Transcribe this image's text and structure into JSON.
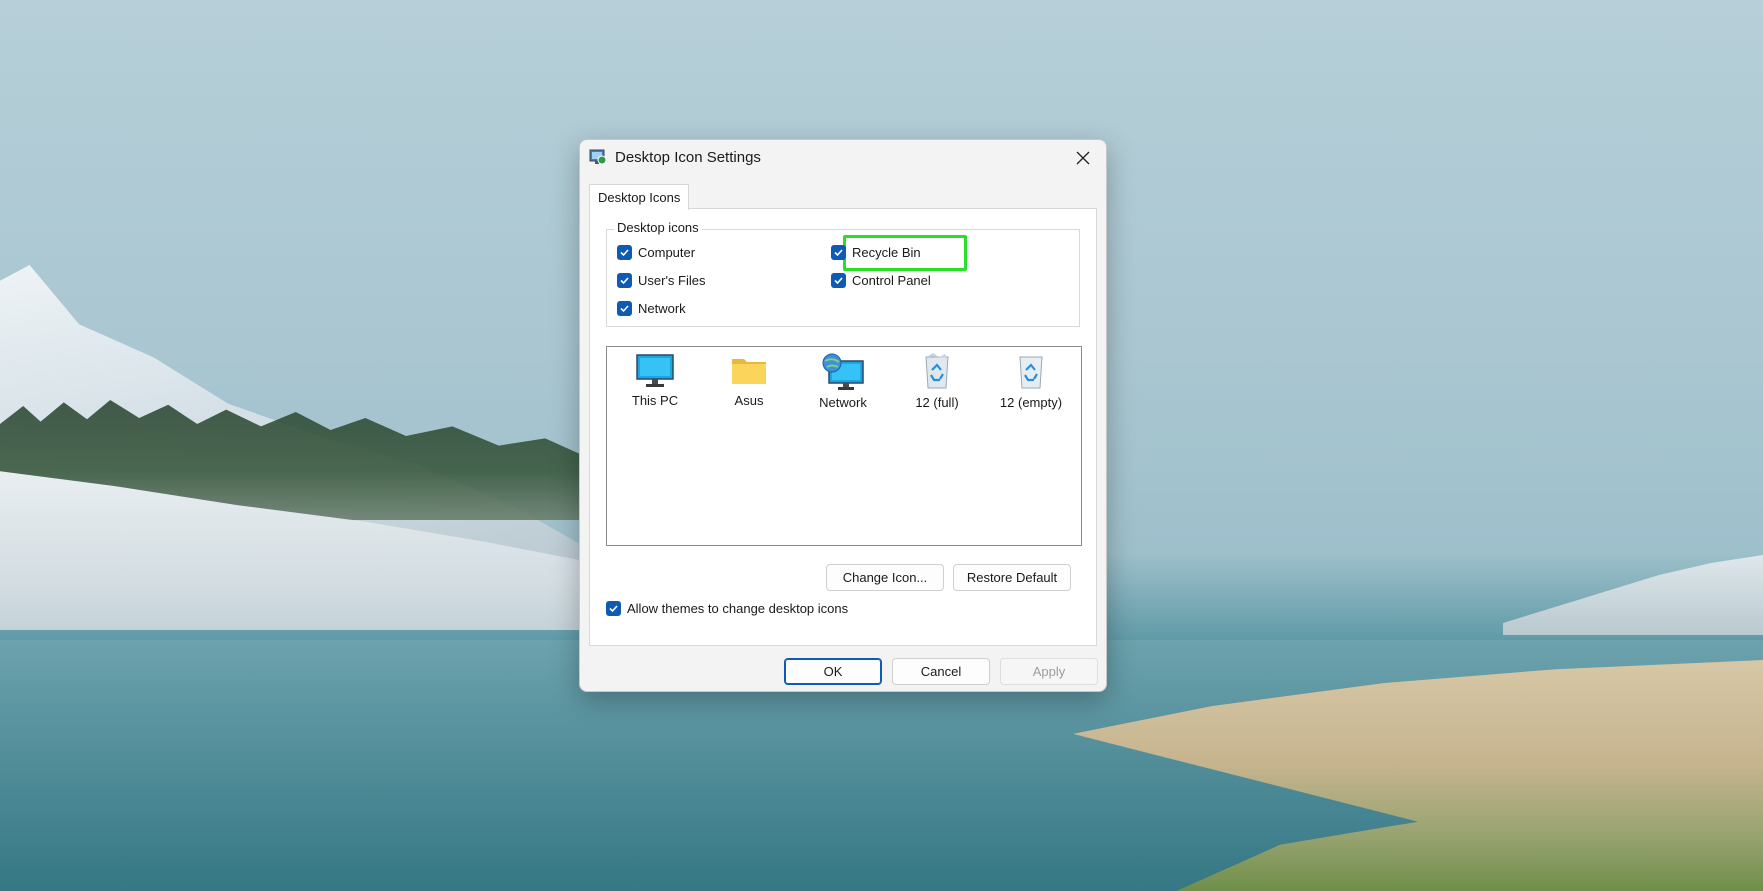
{
  "dialog": {
    "title": "Desktop Icon Settings",
    "app_icon": "desktop-settings-icon",
    "close_icon": "close-icon"
  },
  "tabs": [
    {
      "label": "Desktop Icons",
      "selected": true
    }
  ],
  "desktop_icons_group": {
    "label": "Desktop icons",
    "checkboxes": [
      {
        "label": "Computer",
        "checked": true
      },
      {
        "label": "User's Files",
        "checked": true
      },
      {
        "label": "Network",
        "checked": true
      },
      {
        "label": "Recycle Bin",
        "checked": true,
        "highlighted": true
      },
      {
        "label": "Control Panel",
        "checked": true
      }
    ]
  },
  "icon_list": [
    {
      "label": "This PC",
      "icon": "monitor-icon"
    },
    {
      "label": "Asus",
      "icon": "folder-icon"
    },
    {
      "label": "Network",
      "icon": "network-icon"
    },
    {
      "label": "12 (full)",
      "icon": "recycle-bin-full-icon"
    },
    {
      "label": "12 (empty)",
      "icon": "recycle-bin-empty-icon"
    }
  ],
  "buttons": {
    "change_icon": "Change Icon...",
    "restore_default": "Restore Default",
    "ok": "OK",
    "cancel": "Cancel",
    "apply": "Apply"
  },
  "allow_themes": {
    "label": "Allow themes to change desktop icons",
    "checked": true
  },
  "colors": {
    "accent": "#0f5bb3",
    "highlight_box": "#29e027"
  }
}
